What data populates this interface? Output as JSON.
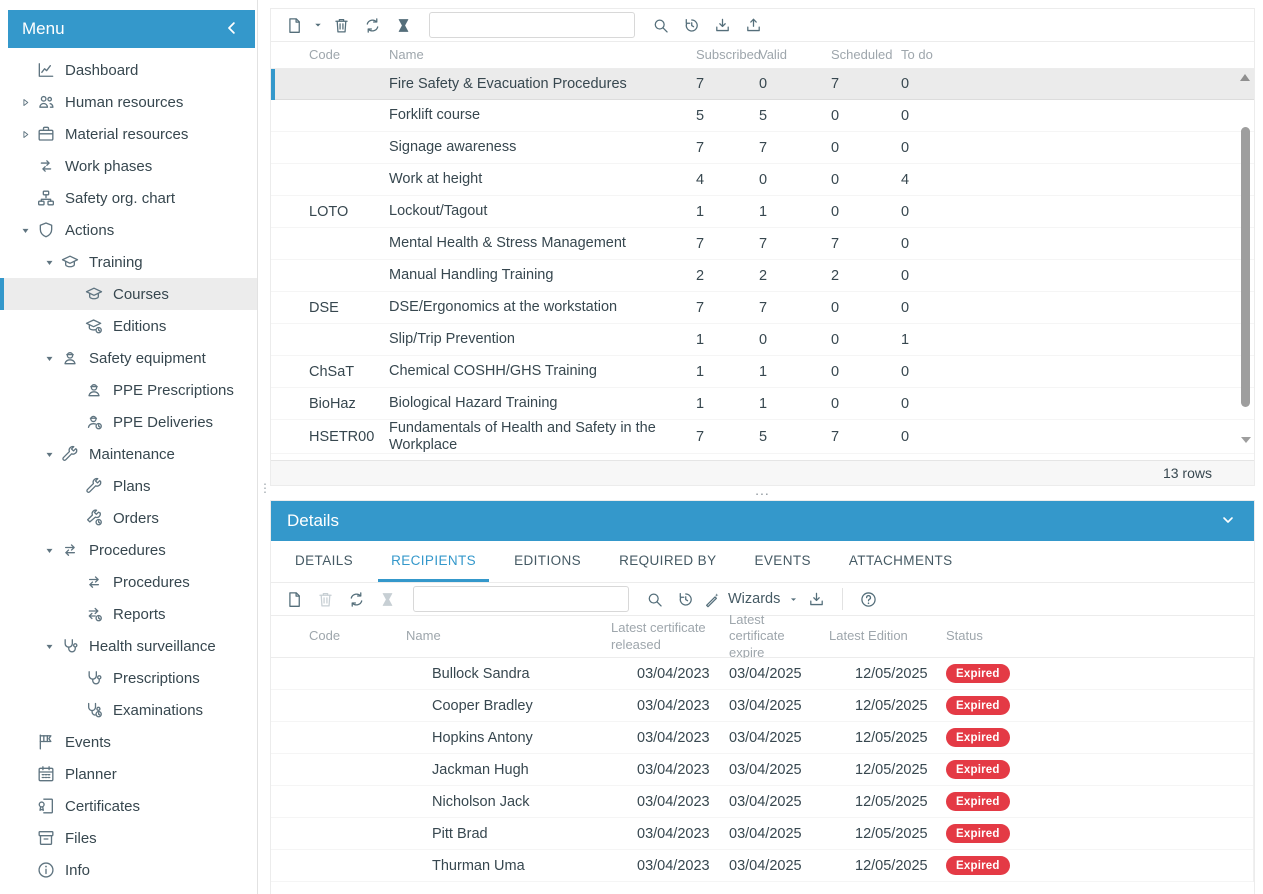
{
  "colors": {
    "accent": "#3498cb",
    "badge_red": "#e43a45",
    "text": "#37474f",
    "muted_header": "#9ea6ac",
    "selected_row_bg": "#ebebeb"
  },
  "menu": {
    "title": "Menu",
    "collapse_icon": "chevron-left-icon",
    "items": [
      {
        "label": "Dashboard",
        "icon": "dashboard-icon",
        "level": 0,
        "expand": "none",
        "selected": false
      },
      {
        "label": "Human resources",
        "icon": "people-icon",
        "level": 0,
        "expand": "collapsed",
        "selected": false
      },
      {
        "label": "Material resources",
        "icon": "toolbox-icon",
        "level": 0,
        "expand": "collapsed",
        "selected": false
      },
      {
        "label": "Work phases",
        "icon": "cycle-icon",
        "level": 0,
        "expand": "none",
        "selected": false
      },
      {
        "label": "Safety org. chart",
        "icon": "org-chart-icon",
        "level": 0,
        "expand": "none",
        "selected": false
      },
      {
        "label": "Actions",
        "icon": "shield-icon",
        "level": 0,
        "expand": "expanded",
        "selected": false
      },
      {
        "label": "Training",
        "icon": "graduation-cap-icon",
        "level": 1,
        "expand": "expanded",
        "selected": false
      },
      {
        "label": "Courses",
        "icon": "graduation-cap-icon",
        "level": 2,
        "expand": "none",
        "selected": true
      },
      {
        "label": "Editions",
        "icon": "graduation-cap-clock-icon",
        "level": 2,
        "expand": "none",
        "selected": false
      },
      {
        "label": "Safety equipment",
        "icon": "ppe-worker-icon",
        "level": 1,
        "expand": "expanded",
        "selected": false
      },
      {
        "label": "PPE Prescriptions",
        "icon": "ppe-worker-icon",
        "level": 2,
        "expand": "none",
        "selected": false
      },
      {
        "label": "PPE Deliveries",
        "icon": "ppe-worker-clock-icon",
        "level": 2,
        "expand": "none",
        "selected": false
      },
      {
        "label": "Maintenance",
        "icon": "wrench-icon",
        "level": 1,
        "expand": "expanded",
        "selected": false
      },
      {
        "label": "Plans",
        "icon": "wrench-icon",
        "level": 2,
        "expand": "none",
        "selected": false
      },
      {
        "label": "Orders",
        "icon": "wrench-clock-icon",
        "level": 2,
        "expand": "none",
        "selected": false
      },
      {
        "label": "Procedures",
        "icon": "swap-arrows-icon",
        "level": 1,
        "expand": "expanded",
        "selected": false
      },
      {
        "label": "Procedures",
        "icon": "swap-arrows-icon",
        "level": 2,
        "expand": "none",
        "selected": false
      },
      {
        "label": "Reports",
        "icon": "swap-arrows-clock-icon",
        "level": 2,
        "expand": "none",
        "selected": false
      },
      {
        "label": "Health surveillance",
        "icon": "stethoscope-icon",
        "level": 1,
        "expand": "expanded",
        "selected": false
      },
      {
        "label": "Prescriptions",
        "icon": "stethoscope-icon",
        "level": 2,
        "expand": "none",
        "selected": false
      },
      {
        "label": "Examinations",
        "icon": "stethoscope-clock-icon",
        "level": 2,
        "expand": "none",
        "selected": false
      },
      {
        "label": "Events",
        "icon": "flag-icon",
        "level": 0,
        "expand": "none",
        "selected": false
      },
      {
        "label": "Planner",
        "icon": "calendar-icon",
        "level": 0,
        "expand": "none",
        "selected": false
      },
      {
        "label": "Certificates",
        "icon": "certificate-icon",
        "level": 0,
        "expand": "none",
        "selected": false
      },
      {
        "label": "Files",
        "icon": "archive-icon",
        "level": 0,
        "expand": "none",
        "selected": false
      },
      {
        "label": "Info",
        "icon": "info-icon",
        "level": 0,
        "expand": "none",
        "selected": false
      }
    ]
  },
  "splitters": {
    "horizontal_handle": "...",
    "vertical_handle": "⋮"
  },
  "courses_panel": {
    "toolbar": {
      "left_buttons": [
        {
          "name": "new-record",
          "icon": "new-document-icon",
          "disabled": false
        },
        {
          "name": "new-caret",
          "icon": "caret-down-icon",
          "disabled": false
        },
        {
          "name": "delete",
          "icon": "trash-icon",
          "disabled": false
        },
        {
          "name": "refresh",
          "icon": "refresh-icon",
          "disabled": false
        },
        {
          "name": "clear-filter",
          "icon": "hourglass-icon",
          "disabled": false
        }
      ],
      "search_value": "",
      "right_buttons": [
        {
          "name": "search",
          "icon": "search-icon",
          "disabled": false
        },
        {
          "name": "history",
          "icon": "history-icon",
          "disabled": false
        },
        {
          "name": "import",
          "icon": "download-icon",
          "disabled": false
        },
        {
          "name": "export",
          "icon": "upload-icon",
          "disabled": false
        }
      ]
    },
    "columns": {
      "code": "Code",
      "name": "Name",
      "subscribed": "Subscribed",
      "valid": "Valid",
      "scheduled": "Scheduled",
      "todo": "To do"
    },
    "rows": [
      {
        "code": "",
        "name": "Fire Safety & Evacuation Procedures",
        "subscribed": 7,
        "valid": 0,
        "scheduled": 7,
        "todo": 0,
        "selected": true
      },
      {
        "code": "",
        "name": "Forklift course",
        "subscribed": 5,
        "valid": 5,
        "scheduled": 0,
        "todo": 0,
        "selected": false
      },
      {
        "code": "",
        "name": "Signage awareness",
        "subscribed": 7,
        "valid": 7,
        "scheduled": 0,
        "todo": 0,
        "selected": false
      },
      {
        "code": "",
        "name": "Work at height",
        "subscribed": 4,
        "valid": 0,
        "scheduled": 0,
        "todo": 4,
        "selected": false
      },
      {
        "code": "LOTO",
        "name": "Lockout/Tagout",
        "subscribed": 1,
        "valid": 1,
        "scheduled": 0,
        "todo": 0,
        "selected": false
      },
      {
        "code": "",
        "name": "Mental Health & Stress Management",
        "subscribed": 7,
        "valid": 7,
        "scheduled": 7,
        "todo": 0,
        "selected": false
      },
      {
        "code": "",
        "name": "Manual Handling Training",
        "subscribed": 2,
        "valid": 2,
        "scheduled": 2,
        "todo": 0,
        "selected": false
      },
      {
        "code": "DSE",
        "name": "DSE/Ergonomics at the workstation",
        "subscribed": 7,
        "valid": 7,
        "scheduled": 0,
        "todo": 0,
        "selected": false
      },
      {
        "code": "",
        "name": "Slip/Trip Prevention",
        "subscribed": 1,
        "valid": 0,
        "scheduled": 0,
        "todo": 1,
        "selected": false
      },
      {
        "code": "ChSaT",
        "name": "Chemical COSHH/GHS Training",
        "subscribed": 1,
        "valid": 1,
        "scheduled": 0,
        "todo": 0,
        "selected": false
      },
      {
        "code": "BioHaz",
        "name": "Biological Hazard Training",
        "subscribed": 1,
        "valid": 1,
        "scheduled": 0,
        "todo": 0,
        "selected": false
      },
      {
        "code": "HSETR00",
        "name": "Fundamentals of Health and Safety in the Workplace",
        "subscribed": 7,
        "valid": 5,
        "scheduled": 7,
        "todo": 0,
        "selected": false
      }
    ],
    "footer": {
      "row_count_label": "13 rows"
    }
  },
  "details_panel": {
    "title": "Details",
    "tabs": [
      {
        "label": "DETAILS",
        "active": false
      },
      {
        "label": "RECIPIENTS",
        "active": true
      },
      {
        "label": "EDITIONS",
        "active": false
      },
      {
        "label": "REQUIRED BY",
        "active": false
      },
      {
        "label": "EVENTS",
        "active": false
      },
      {
        "label": "ATTACHMENTS",
        "active": false
      }
    ],
    "toolbar": {
      "left_buttons": [
        {
          "name": "new-record",
          "icon": "new-document-icon",
          "disabled": false
        },
        {
          "name": "delete",
          "icon": "trash-icon",
          "disabled": true
        },
        {
          "name": "refresh",
          "icon": "refresh-icon",
          "disabled": false
        },
        {
          "name": "clear-filter",
          "icon": "hourglass-icon",
          "disabled": true
        }
      ],
      "search_value": "",
      "mid_buttons": [
        {
          "name": "search",
          "icon": "search-icon",
          "disabled": false
        },
        {
          "name": "history",
          "icon": "history-icon",
          "disabled": false
        }
      ],
      "wizards": {
        "label": "Wizards",
        "icon": "wand-icon",
        "caret_icon": "caret-down-icon"
      },
      "end_buttons": [
        {
          "name": "import",
          "icon": "download-icon",
          "disabled": false
        }
      ],
      "help_icon": "help-icon"
    },
    "columns": {
      "code": "Code",
      "name": "Name",
      "released": "Latest certificate released",
      "expire": "Latest certificate expire",
      "edition": "Latest Edition",
      "status": "Status"
    },
    "row_icons": {
      "name": "person-icon",
      "released": "certificate-icon",
      "edition": "edition-clock-icon"
    },
    "rows": [
      {
        "code": "",
        "name": "Bullock Sandra",
        "released": "03/04/2023",
        "expire": "03/04/2025",
        "edition": "12/05/2025",
        "status": "Expired"
      },
      {
        "code": "",
        "name": "Cooper Bradley",
        "released": "03/04/2023",
        "expire": "03/04/2025",
        "edition": "12/05/2025",
        "status": "Expired"
      },
      {
        "code": "",
        "name": "Hopkins Antony",
        "released": "03/04/2023",
        "expire": "03/04/2025",
        "edition": "12/05/2025",
        "status": "Expired"
      },
      {
        "code": "",
        "name": "Jackman Hugh",
        "released": "03/04/2023",
        "expire": "03/04/2025",
        "edition": "12/05/2025",
        "status": "Expired"
      },
      {
        "code": "",
        "name": "Nicholson Jack",
        "released": "03/04/2023",
        "expire": "03/04/2025",
        "edition": "12/05/2025",
        "status": "Expired"
      },
      {
        "code": "",
        "name": "Pitt Brad",
        "released": "03/04/2023",
        "expire": "03/04/2025",
        "edition": "12/05/2025",
        "status": "Expired"
      },
      {
        "code": "",
        "name": "Thurman Uma",
        "released": "03/04/2023",
        "expire": "03/04/2025",
        "edition": "12/05/2025",
        "status": "Expired"
      }
    ]
  }
}
